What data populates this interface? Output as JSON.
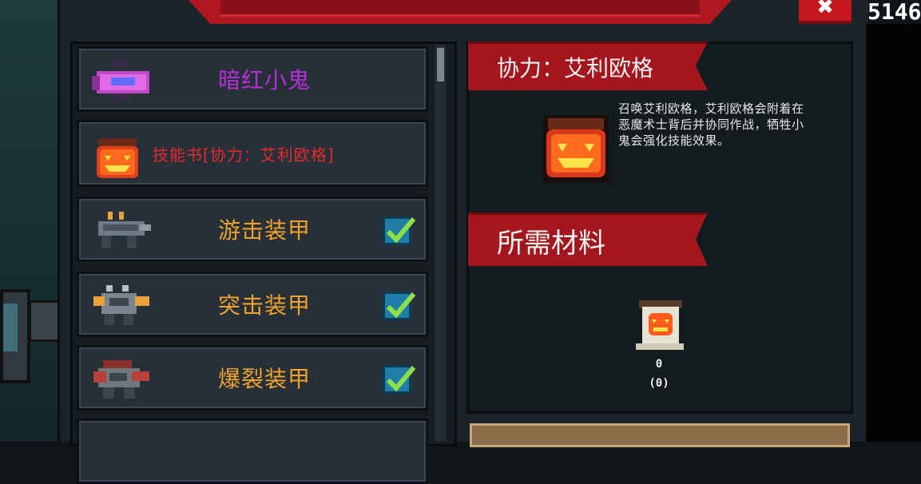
{
  "list": {
    "items": [
      {
        "name": "暗红小鬼",
        "icon": "pink-device-icon",
        "color": "#b62fd8",
        "checked": false
      },
      {
        "name": "技能书[协力：艾利欧格]",
        "icon": "pumpkin-skillbook-icon",
        "color": "#e42b2b",
        "checked": false
      },
      {
        "name": "游击装甲",
        "icon": "guerrilla-armor-icon",
        "color": "#f0a22b",
        "checked": true
      },
      {
        "name": "突击装甲",
        "icon": "assault-armor-icon",
        "color": "#f0a22b",
        "checked": true
      },
      {
        "name": "爆裂装甲",
        "icon": "burst-armor-icon",
        "color": "#f0a22b",
        "checked": true
      }
    ]
  },
  "detail": {
    "title": "协力：艾利欧格",
    "description": "召唤艾利欧格，艾利欧格会附着在恶魔术士背后并协同作战，牺牲小鬼会强化技能效果。",
    "materials_title": "所需材料",
    "material": {
      "icon": "pumpkin-scroll-icon",
      "count": "0",
      "owned": "(0)"
    }
  },
  "topbar": {
    "close_icon": "close-icon",
    "coins": "5146"
  },
  "colors": {
    "accent_red": "#a4161e",
    "check_green": "#8ee04a",
    "check_blue": "#1f7ea8"
  }
}
